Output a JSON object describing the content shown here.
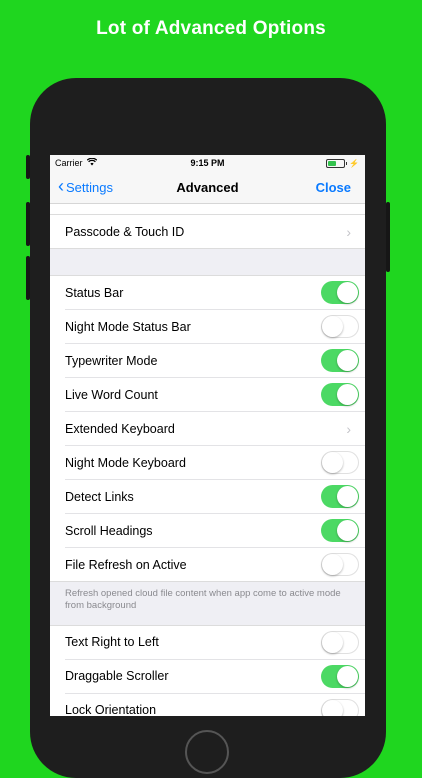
{
  "headline": "Lot of Advanced Options",
  "status_bar": {
    "carrier": "Carrier",
    "time": "9:15 PM"
  },
  "nav": {
    "back_label": "Settings",
    "title": "Advanced",
    "close_label": "Close"
  },
  "group_top": [
    {
      "label": "Passcode & Touch ID",
      "accessory": "chevron"
    }
  ],
  "group_main": [
    {
      "label": "Status Bar",
      "accessory": "toggle",
      "on": true
    },
    {
      "label": "Night Mode Status Bar",
      "accessory": "toggle",
      "on": false
    },
    {
      "label": "Typewriter Mode",
      "accessory": "toggle",
      "on": true
    },
    {
      "label": "Live Word Count",
      "accessory": "toggle",
      "on": true
    },
    {
      "label": "Extended Keyboard",
      "accessory": "chevron"
    },
    {
      "label": "Night Mode Keyboard",
      "accessory": "toggle",
      "on": false
    },
    {
      "label": "Detect Links",
      "accessory": "toggle",
      "on": true
    },
    {
      "label": "Scroll Headings",
      "accessory": "toggle",
      "on": true
    },
    {
      "label": "File Refresh on Active",
      "accessory": "toggle",
      "on": false
    }
  ],
  "footer_note": "Refresh opened cloud file content when app come to active mode from background",
  "group_bottom": [
    {
      "label": "Text Right to Left",
      "accessory": "toggle",
      "on": false
    },
    {
      "label": "Draggable Scroller",
      "accessory": "toggle",
      "on": true
    },
    {
      "label": "Lock Orientation",
      "accessory": "toggle",
      "on": false
    }
  ],
  "colors": {
    "background": "#1fd61f",
    "accent": "#0a7aff",
    "toggle_on": "#4cd964"
  }
}
